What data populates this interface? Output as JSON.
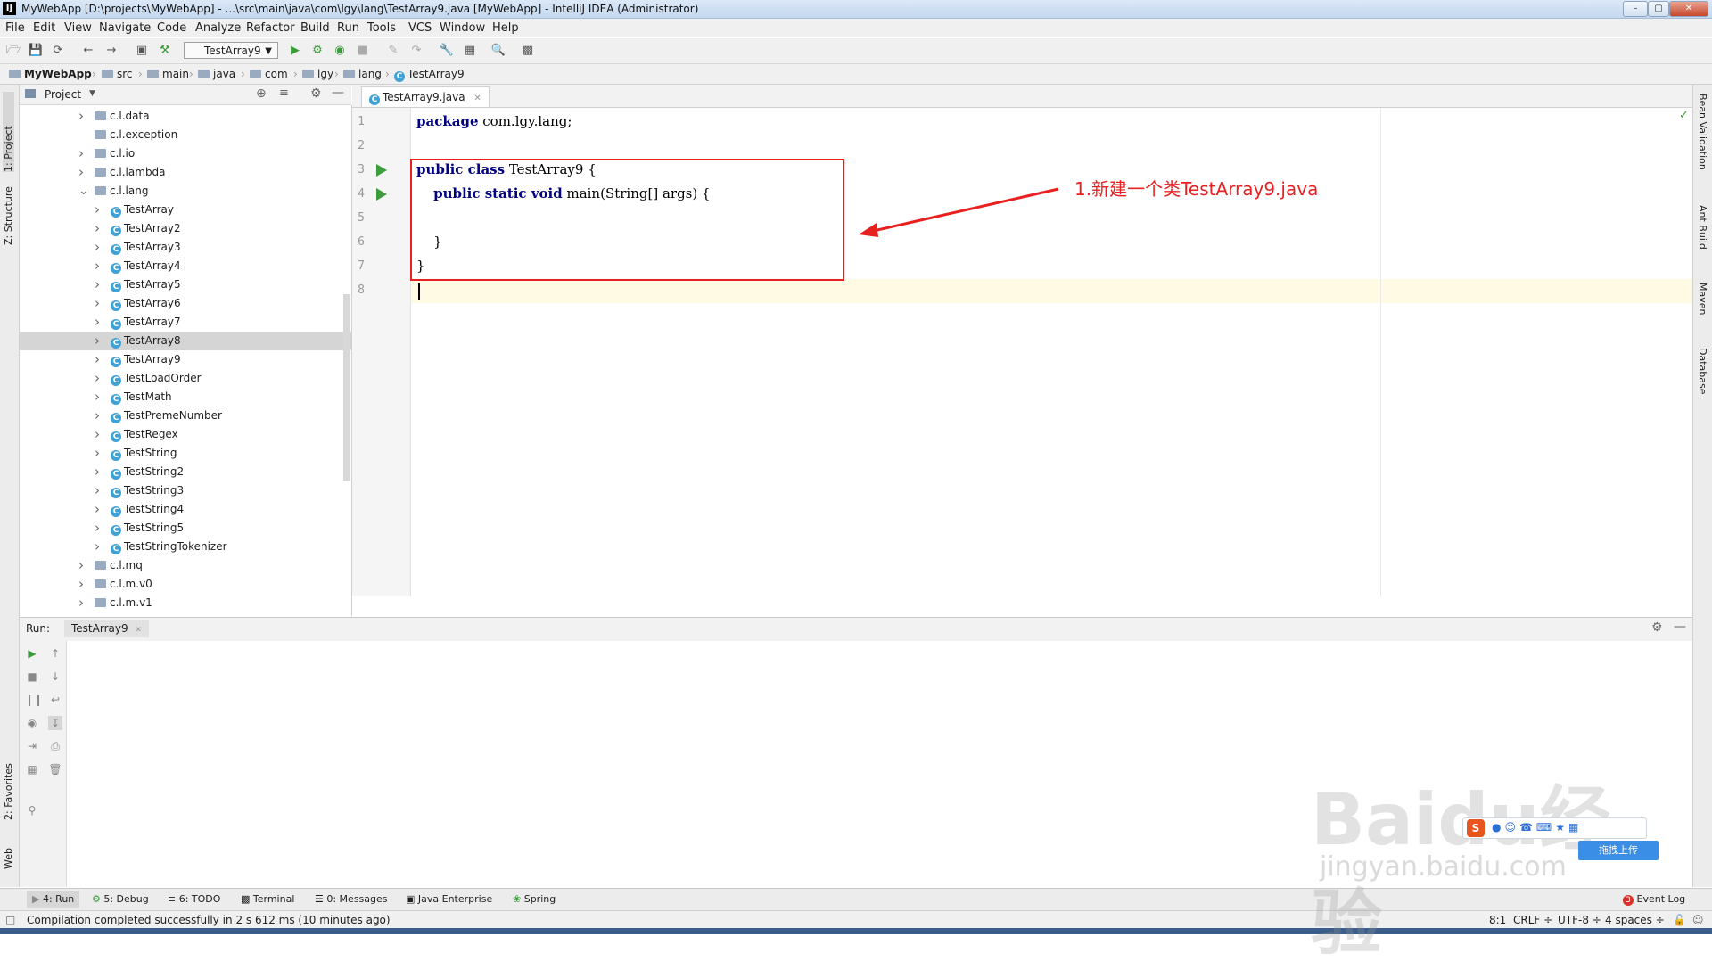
{
  "window": {
    "title": "MyWebApp [D:\\projects\\MyWebApp] - ...\\src\\main\\java\\com\\lgy\\lang\\TestArray9.java [MyWebApp] - IntelliJ IDEA (Administrator)",
    "logo": "IJ"
  },
  "menu": [
    "File",
    "Edit",
    "View",
    "Navigate",
    "Code",
    "Analyze",
    "Refactor",
    "Build",
    "Run",
    "Tools",
    "VCS",
    "Window",
    "Help"
  ],
  "toolbar": {
    "run_config": "TestArray9"
  },
  "breadcrumbs": [
    "MyWebApp",
    "src",
    "main",
    "java",
    "com",
    "lgy",
    "lang",
    "TestArray9"
  ],
  "left_strip": {
    "project": "1: Project",
    "structure": "Z: Structure",
    "favorites": "2: Favorites",
    "web": "Web"
  },
  "right_strip": [
    "Bean Validation",
    "Ant Build",
    "Maven",
    "Database"
  ],
  "project_panel": {
    "title": "Project",
    "items": [
      {
        "label": "c.l.data",
        "type": "package",
        "indent": 0
      },
      {
        "label": "c.l.exception",
        "type": "package-leaf",
        "indent": 0
      },
      {
        "label": "c.l.io",
        "type": "package",
        "indent": 0
      },
      {
        "label": "c.l.lambda",
        "type": "package",
        "indent": 0
      },
      {
        "label": "c.l.lang",
        "type": "package-open",
        "indent": 0
      },
      {
        "label": "TestArray",
        "type": "class",
        "indent": 1
      },
      {
        "label": "TestArray2",
        "type": "class",
        "indent": 1
      },
      {
        "label": "TestArray3",
        "type": "class",
        "indent": 1
      },
      {
        "label": "TestArray4",
        "type": "class",
        "indent": 1
      },
      {
        "label": "TestArray5",
        "type": "class",
        "indent": 1
      },
      {
        "label": "TestArray6",
        "type": "class",
        "indent": 1
      },
      {
        "label": "TestArray7",
        "type": "class",
        "indent": 1
      },
      {
        "label": "TestArray8",
        "type": "class",
        "indent": 1,
        "selected": true
      },
      {
        "label": "TestArray9",
        "type": "class",
        "indent": 1
      },
      {
        "label": "TestLoadOrder",
        "type": "class",
        "indent": 1
      },
      {
        "label": "TestMath",
        "type": "class",
        "indent": 1
      },
      {
        "label": "TestPremeNumber",
        "type": "class",
        "indent": 1
      },
      {
        "label": "TestRegex",
        "type": "class",
        "indent": 1
      },
      {
        "label": "TestString",
        "type": "class",
        "indent": 1
      },
      {
        "label": "TestString2",
        "type": "class",
        "indent": 1
      },
      {
        "label": "TestString3",
        "type": "class",
        "indent": 1
      },
      {
        "label": "TestString4",
        "type": "class",
        "indent": 1
      },
      {
        "label": "TestString5",
        "type": "class",
        "indent": 1
      },
      {
        "label": "TestStringTokenizer",
        "type": "class",
        "indent": 1
      },
      {
        "label": "c.l.mq",
        "type": "package",
        "indent": 0
      },
      {
        "label": "c.l.m.v0",
        "type": "package",
        "indent": 0
      },
      {
        "label": "c.l.m.v1",
        "type": "package",
        "indent": 0
      }
    ]
  },
  "editor": {
    "tab": "TestArray9.java",
    "lines": [
      {
        "n": "1",
        "parts": [
          [
            "kw",
            "package"
          ],
          [
            "t",
            " com.lgy.lang;"
          ]
        ]
      },
      {
        "n": "2",
        "parts": []
      },
      {
        "n": "3",
        "parts": [
          [
            "kw",
            "public class"
          ],
          [
            "t",
            " TestArray9 {"
          ]
        ],
        "run": true
      },
      {
        "n": "4",
        "parts": [
          [
            "t",
            "    "
          ],
          [
            "kw",
            "public static void"
          ],
          [
            "t",
            " main(String[] args) {"
          ]
        ],
        "run": true
      },
      {
        "n": "5",
        "parts": []
      },
      {
        "n": "6",
        "parts": [
          [
            "t",
            "    }"
          ]
        ]
      },
      {
        "n": "7",
        "parts": [
          [
            "t",
            "}"
          ]
        ]
      },
      {
        "n": "8",
        "parts": []
      }
    ],
    "annotation": "1.新建一个类TestArray9.java"
  },
  "run_panel": {
    "label": "Run:",
    "tab": "TestArray9"
  },
  "bottom_tabs": [
    "4: Run",
    "5: Debug",
    "6: TODO",
    "Terminal",
    "0: Messages",
    "Java Enterprise",
    "Spring"
  ],
  "event_log": {
    "count": "3",
    "label": "Event Log"
  },
  "status": {
    "message": "Compilation completed successfully in 2 s 612 ms (10 minutes ago)",
    "position": "8:1",
    "line_sep": "CRLF ÷",
    "encoding": "UTF-8 ÷",
    "indent": "4 spaces ÷"
  },
  "watermark": {
    "brand": "Baidu经验",
    "url": "jingyan.baidu.com",
    "upload": "拖拽上传"
  }
}
